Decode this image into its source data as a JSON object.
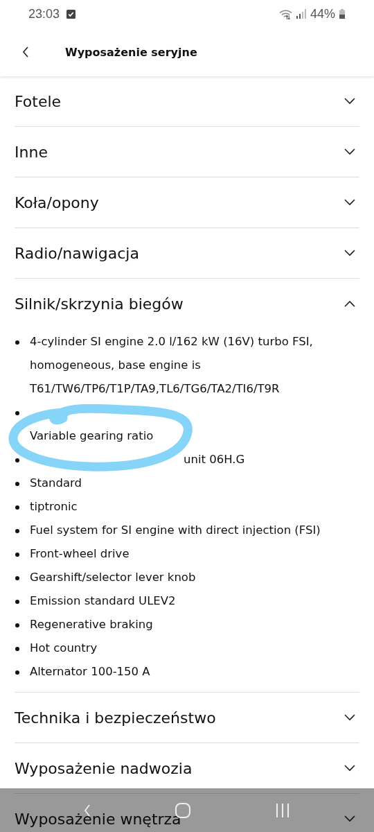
{
  "status_bar": {
    "time": "23:03",
    "battery": "44%"
  },
  "header": {
    "title": "Wyposażenie seryjne"
  },
  "sections": [
    {
      "title": "Fotele",
      "expanded": false
    },
    {
      "title": "Inne",
      "expanded": false
    },
    {
      "title": "Koła/opony",
      "expanded": false
    },
    {
      "title": "Radio/nawigacja",
      "expanded": false
    },
    {
      "title": "Silnik/skrzynia biegów",
      "expanded": true,
      "items": [
        {
          "parts": [
            "4-cylinder SI engine 2.0 l/162 kW (16V) turbo FSI, homogeneous, base engine is T61/TW6/TP6/T1P/TA9,TL6/TG6/TA2/TI6/T9R"
          ],
          "bullet": true
        },
        {
          "bullet": true
        },
        {
          "parts": [
            "Variable gearing ratio"
          ],
          "bullet": false
        },
        {
          "parts": [
            "unit 06H.G"
          ],
          "bullet": true
        },
        {
          "parts": [
            "Standard"
          ],
          "bullet": true
        },
        {
          "parts": [
            "tiptronic"
          ],
          "bullet": true
        },
        {
          "parts": [
            "Fuel system for SI engine with direct injection (FSI)"
          ],
          "bullet": true
        },
        {
          "parts": [
            "Front-wheel drive"
          ],
          "bullet": true
        },
        {
          "parts": [
            "Gearshift/selector lever knob"
          ],
          "bullet": true
        },
        {
          "parts": [
            "Emission standard ULEV2"
          ],
          "bullet": true
        },
        {
          "parts": [
            "Regenerative braking"
          ],
          "bullet": true
        },
        {
          "parts": [
            "Hot country"
          ],
          "bullet": true
        },
        {
          "parts": [
            "Alternator 100-150 A"
          ],
          "bullet": true
        }
      ]
    },
    {
      "title": "Technika i bezpieczeństwo",
      "expanded": false
    },
    {
      "title": "Wyposażenie nadwozia",
      "expanded": false
    },
    {
      "title": "Wyposażenie wnętrza",
      "expanded": false
    }
  ]
}
